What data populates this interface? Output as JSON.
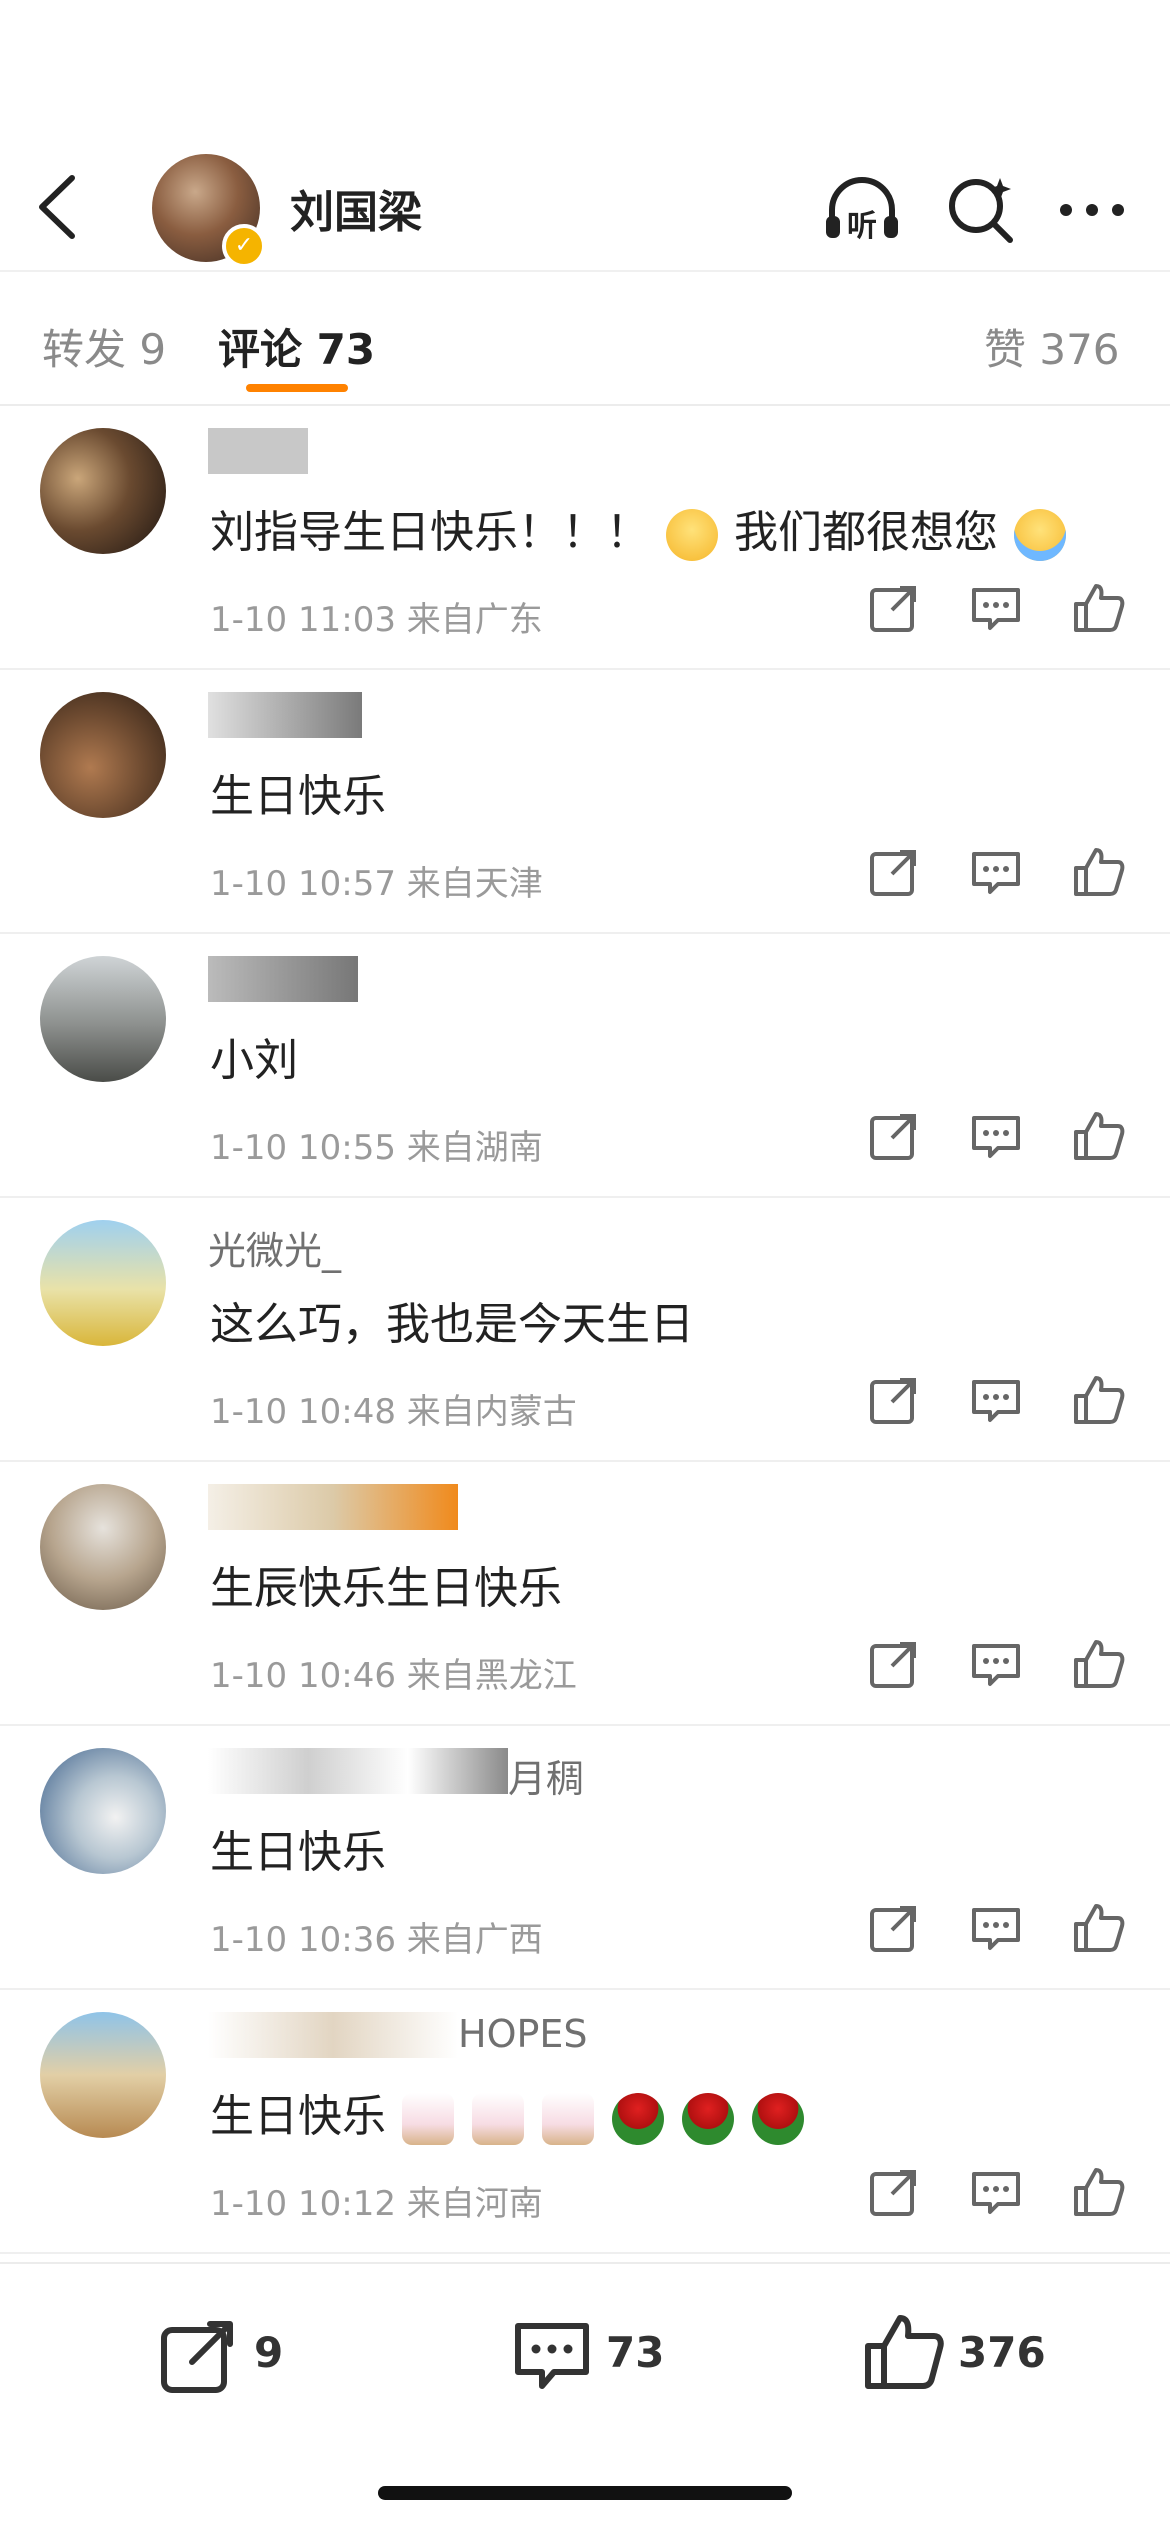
{
  "header": {
    "title": "刘国梁",
    "verified_badge": "✓",
    "icons": [
      "back-icon",
      "listen-icon",
      "search-icon",
      "more-icon"
    ],
    "listen_label": "听"
  },
  "tabs": {
    "repost": "转发 9",
    "comments": "评论 73",
    "likes": "赞 376"
  },
  "comments": [
    {
      "name": "",
      "text_a": "刘指导生日快乐！！！",
      "text_b": "我们都很想您",
      "emoji_a": "blush-face",
      "emoji_b": "crying-face",
      "time": "1-10 11:03",
      "location": "来自广东"
    },
    {
      "name": "",
      "text": "生日快乐",
      "time": "1-10 10:57",
      "location": "来自天津"
    },
    {
      "name": "",
      "text": "小刘",
      "time": "1-10 10:55",
      "location": "来自湖南"
    },
    {
      "name": "光微光_",
      "text": "这么巧，我也是今天生日",
      "time": "1-10 10:48",
      "location": "来自内蒙古"
    },
    {
      "name": "",
      "text": "生辰快乐生日快乐",
      "time": "1-10 10:46",
      "location": "来自黑龙江"
    },
    {
      "name": "月稠",
      "text": "生日快乐",
      "time": "1-10 10:36",
      "location": "来自广西"
    },
    {
      "name": "HOPES",
      "text": "生日快乐",
      "emojis": [
        "cake",
        "cake",
        "cake",
        "rose",
        "rose",
        "rose"
      ],
      "time": "1-10 10:12",
      "location": "来自河南"
    }
  ],
  "bottom_bar": {
    "repost_count": "9",
    "comment_count": "73",
    "like_count": "376"
  },
  "colors": {
    "accent": "#ff8200",
    "verified": "#f5b400",
    "meta_gray": "#9a9a9a"
  }
}
